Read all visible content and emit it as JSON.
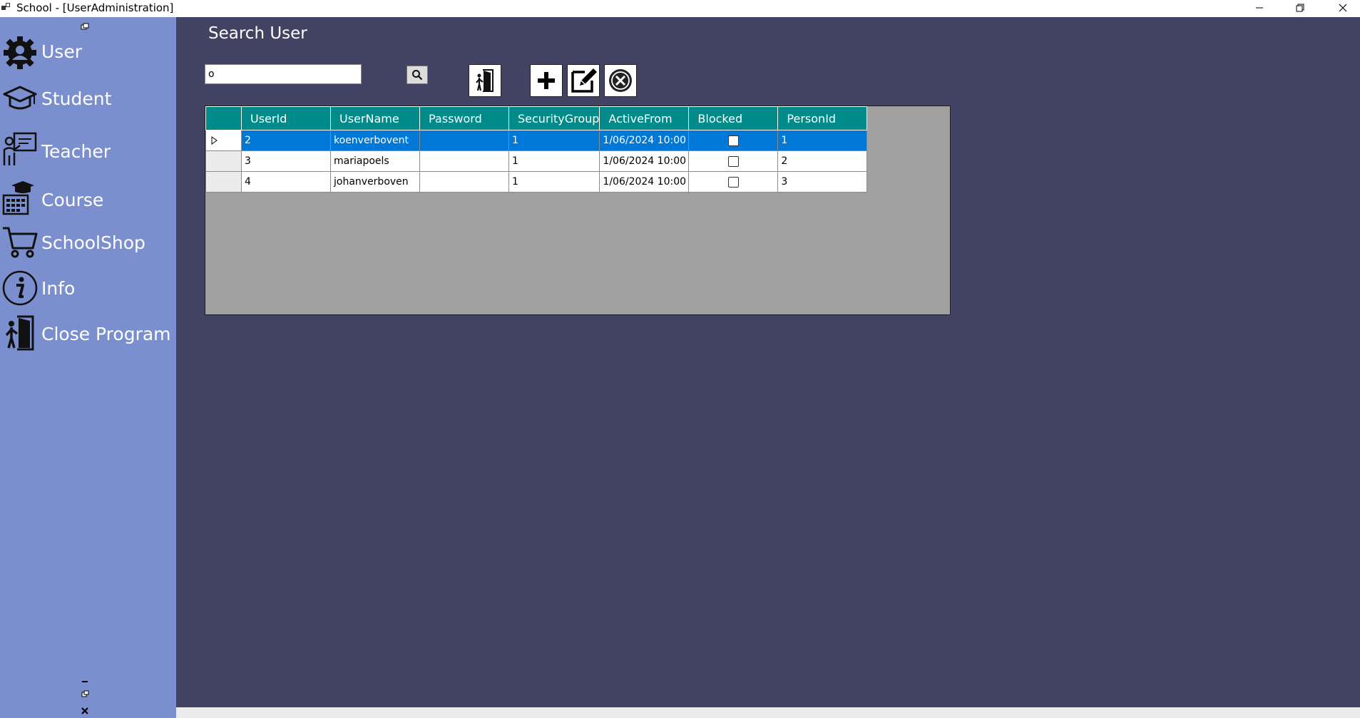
{
  "window": {
    "title": "School - [UserAdministration]",
    "minimize_icon": "minimize-icon",
    "restore_icon": "restore-icon",
    "close_icon": "close-icon"
  },
  "sidebar": {
    "background": "#7b8fce",
    "items": [
      {
        "label": "User",
        "icon": "user-gear-icon"
      },
      {
        "label": "Student",
        "icon": "graduation-cap-icon"
      },
      {
        "label": "Teacher",
        "icon": "teacher-icon"
      },
      {
        "label": "Course",
        "icon": "course-calendar-icon"
      },
      {
        "label": "SchoolShop",
        "icon": "shopping-cart-icon"
      },
      {
        "label": "Info",
        "icon": "info-icon"
      },
      {
        "label": "Close Program",
        "icon": "exit-door-icon"
      }
    ],
    "mdi_controls": [
      "minimize-icon",
      "restore-icon",
      "close-icon"
    ]
  },
  "main": {
    "background": "#424262",
    "title": "Search User",
    "search": {
      "value": "o",
      "button_icon": "search-icon"
    },
    "toolbar": [
      "exit-door-icon",
      "add-icon",
      "edit-icon",
      "delete-icon"
    ]
  },
  "grid": {
    "header_color": "#008b8b",
    "selected_color": "#0078d7",
    "columns": [
      "UserId",
      "UserName",
      "Password",
      "SecurityGroup",
      "ActiveFrom",
      "Blocked",
      "PersonId"
    ],
    "rows": [
      {
        "UserId": "2",
        "UserName": "koenverbovent",
        "Password": "",
        "SecurityGroup": "1",
        "ActiveFrom": "1/06/2024 10:00",
        "Blocked": false,
        "PersonId": "1",
        "selected": true
      },
      {
        "UserId": "3",
        "UserName": "mariapoels",
        "Password": "",
        "SecurityGroup": "1",
        "ActiveFrom": "1/06/2024 10:00",
        "Blocked": false,
        "PersonId": "2",
        "selected": false
      },
      {
        "UserId": "4",
        "UserName": "johanverboven",
        "Password": "",
        "SecurityGroup": "1",
        "ActiveFrom": "1/06/2024 10:00",
        "Blocked": false,
        "PersonId": "3",
        "selected": false
      }
    ]
  }
}
